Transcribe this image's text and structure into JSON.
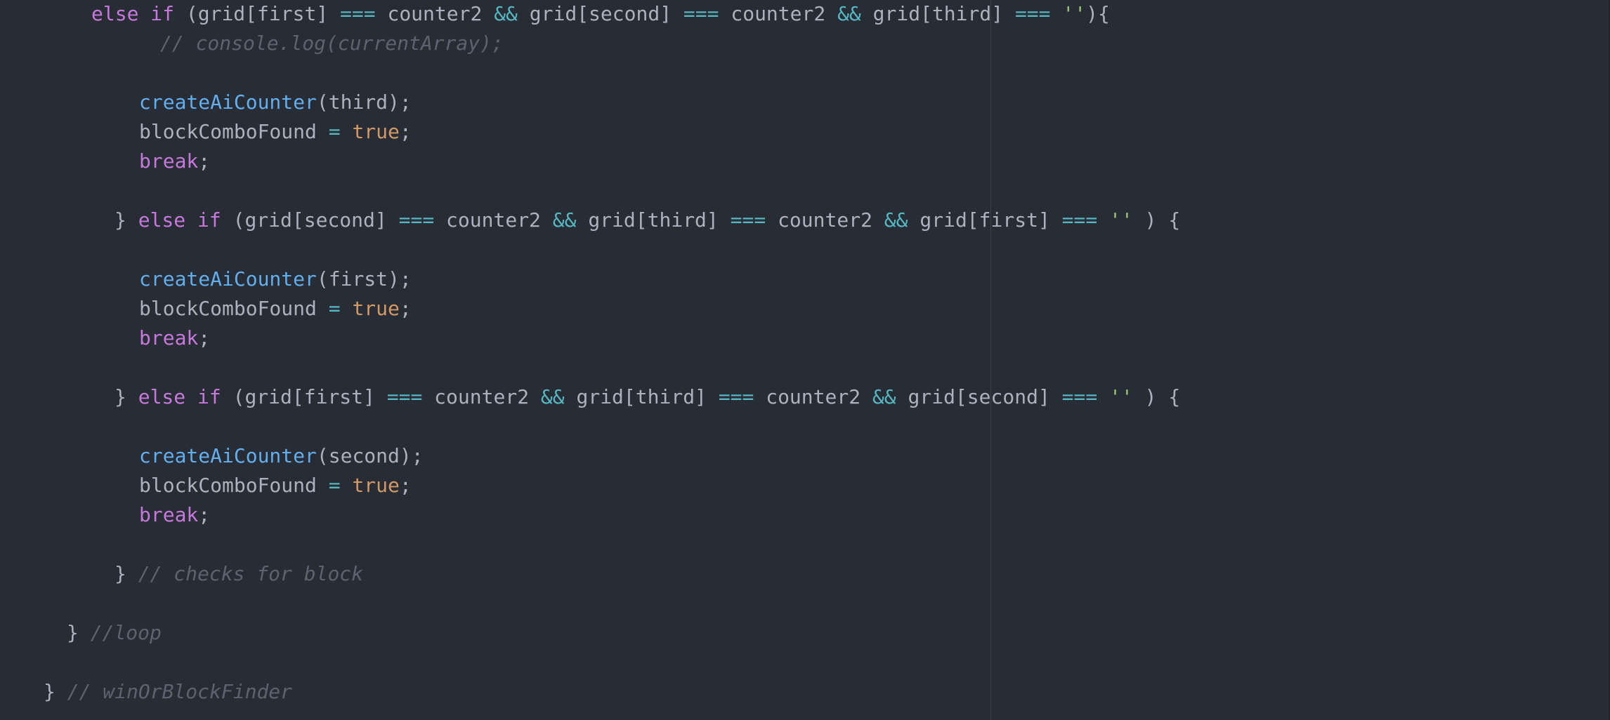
{
  "editor": {
    "theme_colors": {
      "background": "#282c34",
      "keyword": "#c678dd",
      "function": "#61afef",
      "operator": "#56b6c2",
      "string": "#98c379",
      "boolean": "#d19a66",
      "comment": "#5c6370",
      "plain": "#abb2bf"
    },
    "lines": [
      {
        "indent": 0,
        "tokens": [
          {
            "t": "kw",
            "v": "else if"
          },
          {
            "t": "pl",
            "v": " (grid[first] "
          },
          {
            "t": "op",
            "v": "==="
          },
          {
            "t": "pl",
            "v": " counter2 "
          },
          {
            "t": "op",
            "v": "&&"
          },
          {
            "t": "pl",
            "v": " grid[second] "
          },
          {
            "t": "op",
            "v": "==="
          },
          {
            "t": "pl",
            "v": " counter2 "
          },
          {
            "t": "op",
            "v": "&&"
          },
          {
            "t": "pl",
            "v": " grid[third] "
          },
          {
            "t": "op",
            "v": "==="
          },
          {
            "t": "pl",
            "v": " "
          },
          {
            "t": "str",
            "v": "''"
          },
          {
            "t": "pl",
            "v": "){"
          }
        ]
      },
      {
        "indent": 0,
        "tokens": [
          {
            "t": "cm",
            "v": "// console.log(currentArray);"
          }
        ]
      },
      {
        "indent": 0,
        "tokens": []
      },
      {
        "indent": 0,
        "tokens": [
          {
            "t": "fn",
            "v": "createAiCounter"
          },
          {
            "t": "pl",
            "v": "(third);"
          }
        ]
      },
      {
        "indent": 0,
        "tokens": [
          {
            "t": "pl",
            "v": "blockComboFound "
          },
          {
            "t": "op",
            "v": "="
          },
          {
            "t": "pl",
            "v": " "
          },
          {
            "t": "bool",
            "v": "true"
          },
          {
            "t": "pl",
            "v": ";"
          }
        ]
      },
      {
        "indent": 0,
        "tokens": [
          {
            "t": "kw",
            "v": "break"
          },
          {
            "t": "pl",
            "v": ";"
          }
        ]
      },
      {
        "indent": 0,
        "tokens": []
      },
      {
        "indent": 0,
        "tokens": [
          {
            "t": "pl",
            "v": "} "
          },
          {
            "t": "kw",
            "v": "else if"
          },
          {
            "t": "pl",
            "v": " (grid[second] "
          },
          {
            "t": "op",
            "v": "==="
          },
          {
            "t": "pl",
            "v": " counter2 "
          },
          {
            "t": "op",
            "v": "&&"
          },
          {
            "t": "pl",
            "v": " grid[third] "
          },
          {
            "t": "op",
            "v": "==="
          },
          {
            "t": "pl",
            "v": " counter2 "
          },
          {
            "t": "op",
            "v": "&&"
          },
          {
            "t": "pl",
            "v": " grid[first] "
          },
          {
            "t": "op",
            "v": "==="
          },
          {
            "t": "pl",
            "v": " "
          },
          {
            "t": "str",
            "v": "''"
          },
          {
            "t": "pl",
            "v": " ) {"
          }
        ]
      },
      {
        "indent": 0,
        "tokens": []
      },
      {
        "indent": 0,
        "tokens": [
          {
            "t": "fn",
            "v": "createAiCounter"
          },
          {
            "t": "pl",
            "v": "(first);"
          }
        ]
      },
      {
        "indent": 0,
        "tokens": [
          {
            "t": "pl",
            "v": "blockComboFound "
          },
          {
            "t": "op",
            "v": "="
          },
          {
            "t": "pl",
            "v": " "
          },
          {
            "t": "bool",
            "v": "true"
          },
          {
            "t": "pl",
            "v": ";"
          }
        ]
      },
      {
        "indent": 0,
        "tokens": [
          {
            "t": "kw",
            "v": "break"
          },
          {
            "t": "pl",
            "v": ";"
          }
        ]
      },
      {
        "indent": 0,
        "tokens": []
      },
      {
        "indent": 0,
        "tokens": [
          {
            "t": "pl",
            "v": "} "
          },
          {
            "t": "kw",
            "v": "else if"
          },
          {
            "t": "pl",
            "v": " (grid[first] "
          },
          {
            "t": "op",
            "v": "==="
          },
          {
            "t": "pl",
            "v": " counter2 "
          },
          {
            "t": "op",
            "v": "&&"
          },
          {
            "t": "pl",
            "v": " grid[third] "
          },
          {
            "t": "op",
            "v": "==="
          },
          {
            "t": "pl",
            "v": " counter2 "
          },
          {
            "t": "op",
            "v": "&&"
          },
          {
            "t": "pl",
            "v": " grid[second] "
          },
          {
            "t": "op",
            "v": "==="
          },
          {
            "t": "pl",
            "v": " "
          },
          {
            "t": "str",
            "v": "''"
          },
          {
            "t": "pl",
            "v": " ) {"
          }
        ]
      },
      {
        "indent": 0,
        "tokens": []
      },
      {
        "indent": 0,
        "tokens": [
          {
            "t": "fn",
            "v": "createAiCounter"
          },
          {
            "t": "pl",
            "v": "(second);"
          }
        ]
      },
      {
        "indent": 0,
        "tokens": [
          {
            "t": "pl",
            "v": "blockComboFound "
          },
          {
            "t": "op",
            "v": "="
          },
          {
            "t": "pl",
            "v": " "
          },
          {
            "t": "bool",
            "v": "true"
          },
          {
            "t": "pl",
            "v": ";"
          }
        ]
      },
      {
        "indent": 0,
        "tokens": [
          {
            "t": "kw",
            "v": "break"
          },
          {
            "t": "pl",
            "v": ";"
          }
        ]
      },
      {
        "indent": 0,
        "tokens": []
      },
      {
        "indent": 0,
        "tokens": [
          {
            "t": "pl",
            "v": "} "
          },
          {
            "t": "cm",
            "v": "// checks for block"
          }
        ]
      },
      {
        "indent": 0,
        "tokens": []
      },
      {
        "indent": 0,
        "tokens": [
          {
            "t": "pl",
            "v": "} "
          },
          {
            "t": "cm",
            "v": "//loop"
          }
        ]
      },
      {
        "indent": 0,
        "tokens": []
      },
      {
        "indent": 0,
        "tokens": [
          {
            "t": "pl",
            "v": "} "
          },
          {
            "t": "cm",
            "v": "// winOrBlockFinder"
          }
        ]
      }
    ]
  }
}
